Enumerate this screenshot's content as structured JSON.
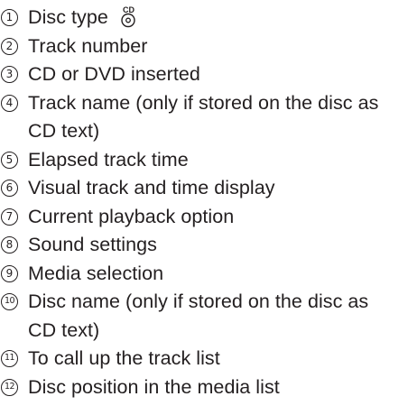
{
  "legend": {
    "items": [
      {
        "number": "1",
        "text": "Disc type",
        "icon": "cd-disc-icon"
      },
      {
        "number": "2",
        "text": "Track number"
      },
      {
        "number": "3",
        "text": "CD or DVD inserted"
      },
      {
        "number": "4",
        "text": "Track name (only if stored on the disc as",
        "continuation": "CD text)"
      },
      {
        "number": "5",
        "text": "Elapsed track time"
      },
      {
        "number": "6",
        "text": "Visual track and time display"
      },
      {
        "number": "7",
        "text": "Current playback option"
      },
      {
        "number": "8",
        "text": "Sound settings"
      },
      {
        "number": "9",
        "text": "Media selection"
      },
      {
        "number": "10",
        "text": "Disc name (only if stored on the disc as",
        "continuation": "CD text)"
      },
      {
        "number": "11",
        "text": "To call up the track list"
      },
      {
        "number": "12",
        "text": "Disc position in the media list"
      }
    ],
    "icon_label": "CD"
  }
}
